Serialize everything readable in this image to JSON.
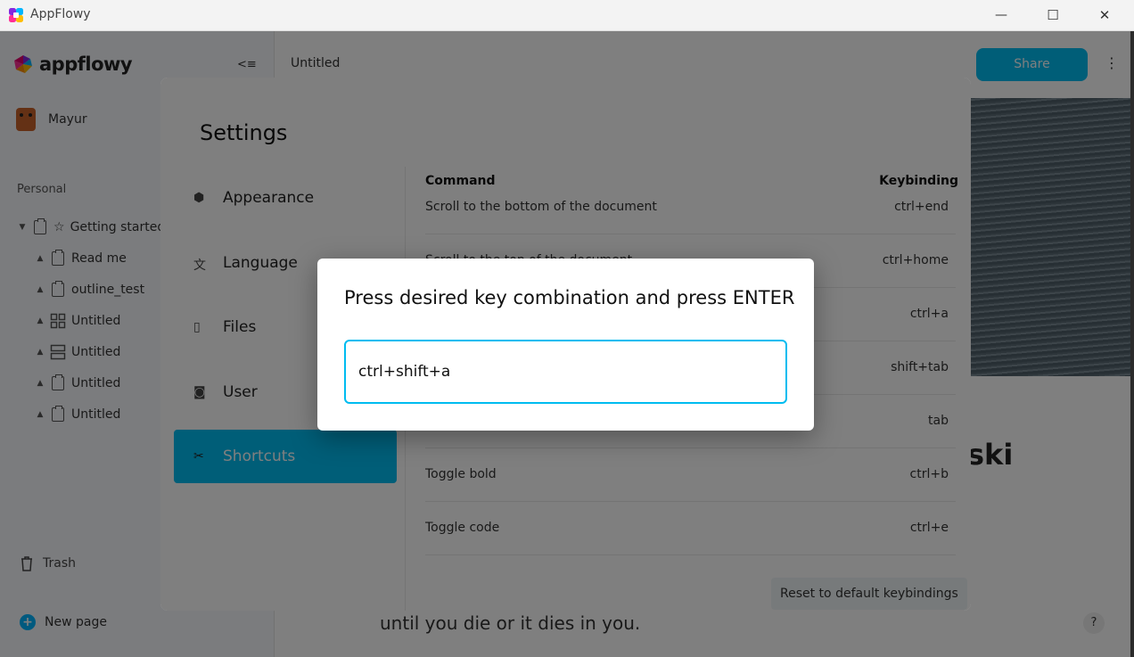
{
  "window": {
    "title": "AppFlowy",
    "minimize_glyph": "—",
    "maximize_glyph": "☐",
    "close_glyph": "✕"
  },
  "sidebar": {
    "brand": "appflowy",
    "collapse_glyph": "<≡",
    "user_name": "Mayur",
    "section_label": "Personal",
    "items": [
      {
        "label": "Getting started",
        "icon": "document-icon",
        "prefix": "☆"
      },
      {
        "label": "Read me",
        "icon": "document-icon"
      },
      {
        "label": "outline_test",
        "icon": "document-icon"
      },
      {
        "label": "Untitled",
        "icon": "grid-icon"
      },
      {
        "label": "Untitled",
        "icon": "board-icon"
      },
      {
        "label": "Untitled",
        "icon": "document-icon"
      },
      {
        "label": "Untitled",
        "icon": "document-icon"
      }
    ],
    "trash_label": "Trash",
    "new_page_label": "New page"
  },
  "main": {
    "breadcrumb": "Untitled",
    "share_label": "Share",
    "more_glyph": "⋮",
    "big_text": "ski",
    "quote": "until you die or it dies in you.",
    "help_glyph": "?"
  },
  "settings": {
    "title": "Settings",
    "nav": [
      {
        "label": "Appearance",
        "icon": "appearance-icon",
        "active": false
      },
      {
        "label": "Language",
        "icon": "language-icon",
        "active": false
      },
      {
        "label": "Files",
        "icon": "files-icon",
        "active": false
      },
      {
        "label": "User",
        "icon": "user-icon",
        "active": false
      },
      {
        "label": "Shortcuts",
        "icon": "scissors-icon",
        "active": true
      }
    ],
    "table": {
      "command_header": "Command",
      "keybinding_header": "Keybinding",
      "rows": [
        {
          "command": "Scroll to the bottom of the document",
          "key": "ctrl+end"
        },
        {
          "command": "Scroll to the top of the document",
          "key": "ctrl+home"
        },
        {
          "command": "",
          "key": "ctrl+a"
        },
        {
          "command": "",
          "key": "shift+tab"
        },
        {
          "command": "",
          "key": "tab"
        },
        {
          "command": "Toggle bold",
          "key": "ctrl+b"
        },
        {
          "command": "Toggle code",
          "key": "ctrl+e"
        }
      ]
    },
    "reset_label": "Reset to default keybindings"
  },
  "modal": {
    "prompt": "Press desired key combination and press ENTER",
    "value": "ctrl+shift+a"
  },
  "colors": {
    "accent": "#00bcf0",
    "brand_blue": "#00b5ff"
  }
}
